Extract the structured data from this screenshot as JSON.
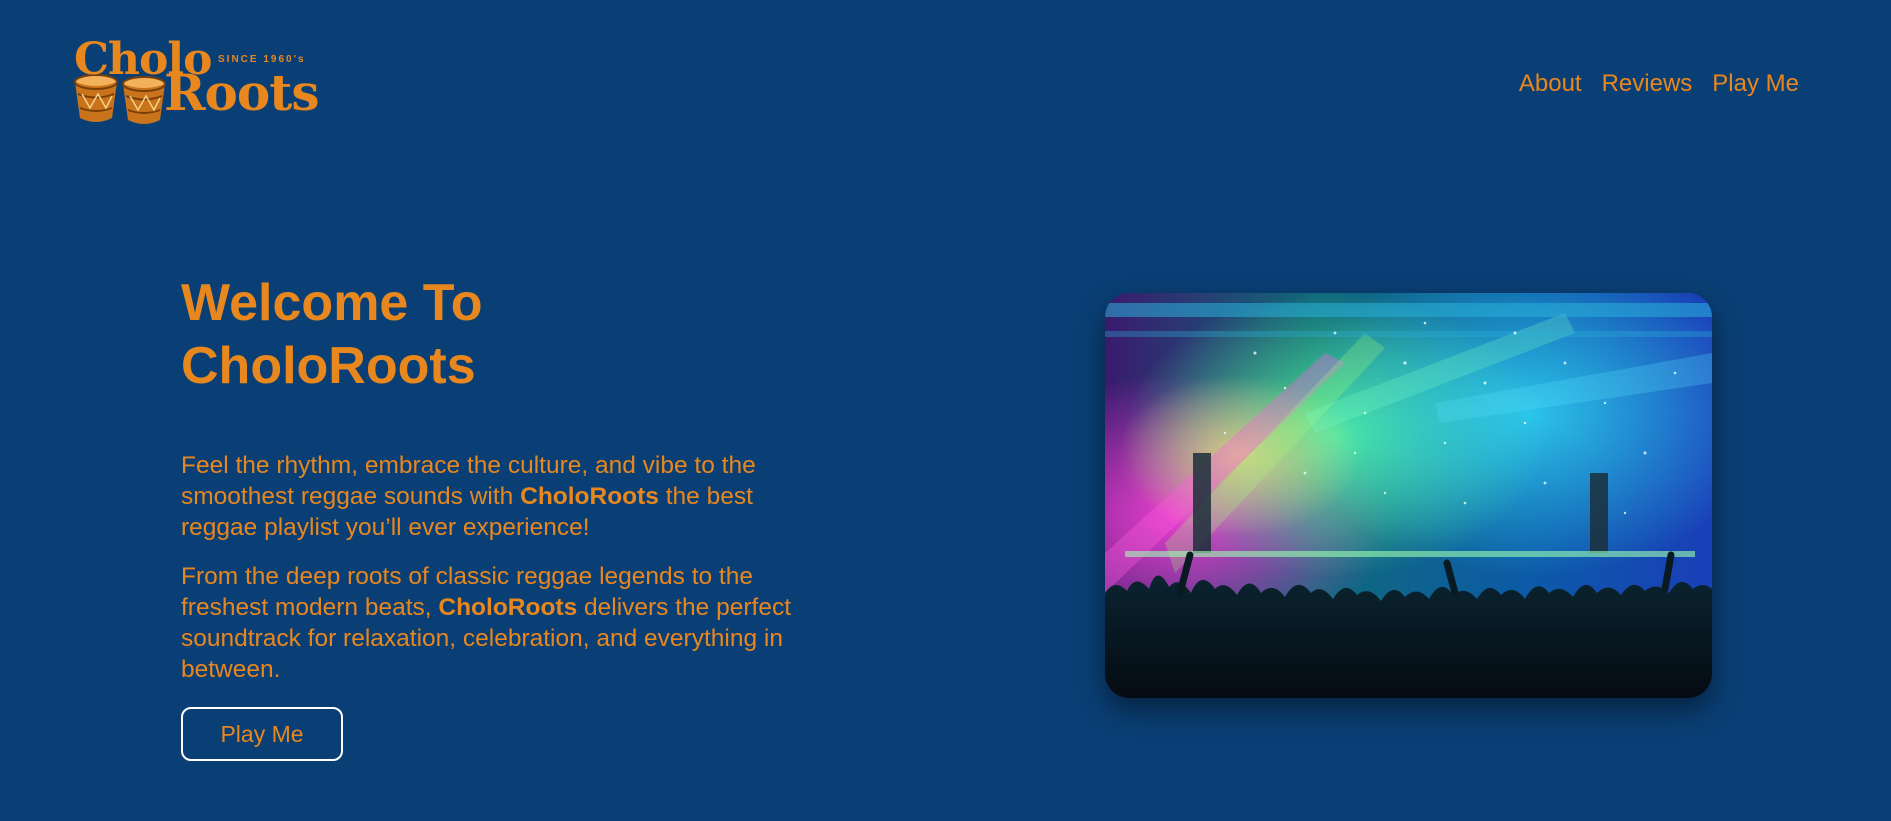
{
  "logo": {
    "word1": "Cholo",
    "word2": "Roots",
    "since": "SINCE 1960's",
    "icon": "bongo-drums-icon"
  },
  "nav": {
    "items": [
      {
        "label": "About"
      },
      {
        "label": "Reviews"
      },
      {
        "label": "Play Me"
      }
    ]
  },
  "hero": {
    "title": "Welcome To CholoRoots",
    "paragraph1": {
      "before": "Feel the rhythm, embrace the culture, and vibe to the smoothest reggae sounds with ",
      "brand": "CholoRoots",
      "after": " the best reggae playlist you’ll ever experience!"
    },
    "paragraph2": {
      "before": "From the deep roots of classic reggae legends to the freshest modern beats, ",
      "brand": "CholoRoots",
      "after": " delivers the perfect soundtrack for relaxation, celebration, and everything in between."
    },
    "cta_label": "Play Me",
    "image_alt": "concert-crowd-with-colorful-stage-lights"
  },
  "colors": {
    "background": "#0a3f75",
    "accent": "#e8871e",
    "button_border": "#ffffff"
  }
}
